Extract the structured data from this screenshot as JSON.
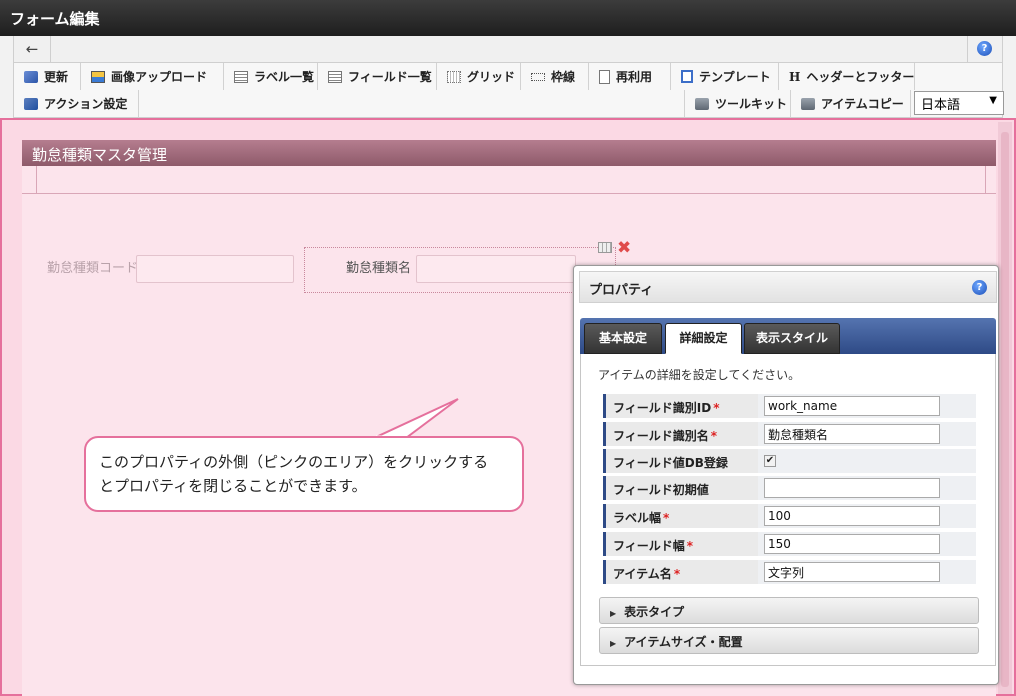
{
  "window": {
    "title": "フォーム編集"
  },
  "navbar": {
    "back_icon": "←",
    "help_icon": "?"
  },
  "toolbar": {
    "row1": [
      {
        "label": "更新",
        "icon": "refresh-icon"
      },
      {
        "label": "画像アップロード",
        "icon": "image-upload-icon"
      },
      {
        "label": "ラベル一覧",
        "icon": "list-icon"
      },
      {
        "label": "フィールド一覧",
        "icon": "list-icon"
      },
      {
        "label": "グリッド",
        "icon": "grid-icon"
      },
      {
        "label": "枠線",
        "icon": "frame-icon"
      },
      {
        "label": "再利用",
        "icon": "document-icon"
      },
      {
        "label": "テンプレート",
        "icon": "template-icon"
      },
      {
        "label": "ヘッダーとフッター",
        "icon": "header-icon"
      }
    ],
    "header_glyph": "H",
    "row2_left": {
      "label": "アクション設定",
      "icon": "action-icon"
    },
    "row2_right": [
      {
        "label": "ツールキット",
        "icon": "toolbox-icon"
      },
      {
        "label": "アイテムコピー",
        "icon": "toolbox-icon"
      }
    ],
    "language": {
      "selected": "日本語",
      "arrow": "▼"
    }
  },
  "form": {
    "title": "勤怠種類マスタ管理",
    "fields": [
      {
        "label": "勤怠種類コード"
      },
      {
        "label": "勤怠種類名"
      }
    ],
    "close_glyph": "✖"
  },
  "callout": {
    "text_line1": "このプロパティの外側（ピンクのエリア）をクリックする",
    "text_line2": "とプロパティを閉じることができます。"
  },
  "properties": {
    "title": "プロパティ",
    "help_icon": "?",
    "tabs": [
      "基本設定",
      "詳細設定",
      "表示スタイル"
    ],
    "active_tab": "詳細設定",
    "description": "アイテムの詳細を設定してください。",
    "required_mark": "*",
    "check_glyph": "✔",
    "rows": [
      {
        "label": "フィールド識別ID",
        "required": true,
        "type": "text",
        "value": "work_name"
      },
      {
        "label": "フィールド識別名",
        "required": true,
        "type": "text",
        "value": "勤怠種類名"
      },
      {
        "label": "フィールド値DB登録",
        "required": false,
        "type": "checkbox",
        "checked": true
      },
      {
        "label": "フィールド初期値",
        "required": false,
        "type": "text",
        "value": ""
      },
      {
        "label": "ラベル幅",
        "required": true,
        "type": "text",
        "value": "100"
      },
      {
        "label": "フィールド幅",
        "required": true,
        "type": "text",
        "value": "150"
      },
      {
        "label": "アイテム名",
        "required": true,
        "type": "text",
        "value": "文字列"
      }
    ],
    "sections": [
      "表示タイプ",
      "アイテムサイズ・配置"
    ],
    "section_arrow": "▶"
  },
  "colors": {
    "titlebar": "#2b2b2b",
    "overlay_pink": "#fbd9e4",
    "overlay_border": "#e5709c",
    "form_header": "#9c6878",
    "tab_bar": "#2e4a86",
    "required": "#dd2222"
  }
}
